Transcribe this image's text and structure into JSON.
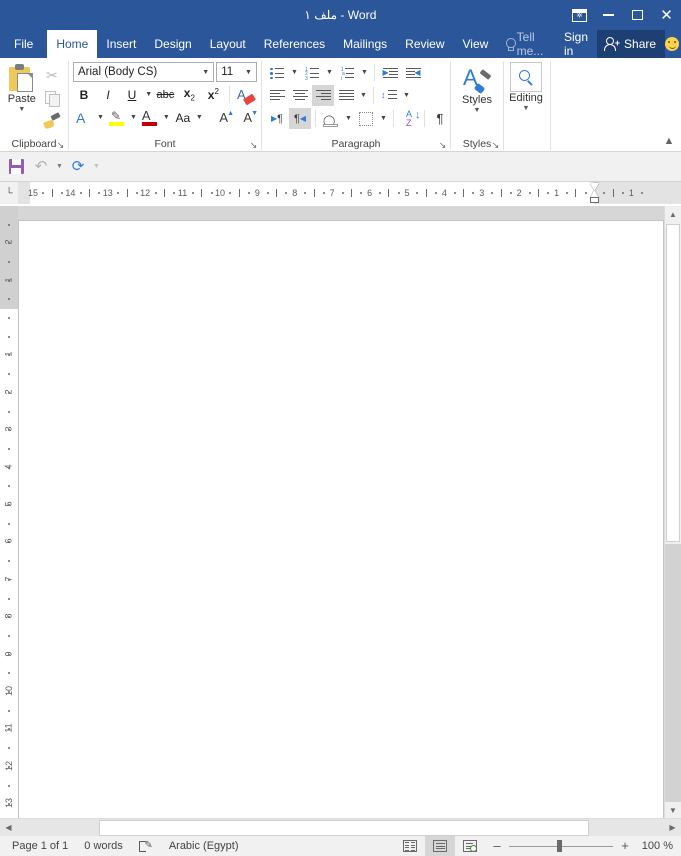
{
  "window": {
    "title": "ملف ١ - Word",
    "ribbon_display_options_tooltip": "Ribbon Display Options",
    "minimize": "–",
    "maximize": "□",
    "close": "✕"
  },
  "tabs": [
    {
      "label": "File",
      "id": "file",
      "active": false
    },
    {
      "label": "Home",
      "id": "home",
      "active": true
    },
    {
      "label": "Insert",
      "id": "insert",
      "active": false
    },
    {
      "label": "Design",
      "id": "design",
      "active": false
    },
    {
      "label": "Layout",
      "id": "layout",
      "active": false
    },
    {
      "label": "References",
      "id": "references",
      "active": false
    },
    {
      "label": "Mailings",
      "id": "mailings",
      "active": false
    },
    {
      "label": "Review",
      "id": "review",
      "active": false
    },
    {
      "label": "View",
      "id": "view",
      "active": false
    }
  ],
  "account": {
    "tell_me": "Tell me...",
    "sign_in": "Sign in",
    "share": "Share",
    "feedback_icon": "smiley-icon"
  },
  "ribbon": {
    "groups": {
      "clipboard": {
        "label": "Clipboard",
        "paste": "Paste",
        "cut_icon": "scissors-icon",
        "copy_icon": "copy-icon",
        "format_painter_icon": "format-painter-icon",
        "launcher": "↘"
      },
      "font": {
        "label": "Font",
        "font_name": "Arial (Body CS)",
        "font_size": "11",
        "bold": "B",
        "italic": "I",
        "underline": "U",
        "strikethrough": "abc",
        "subscript": "x",
        "subscript_sub": "2",
        "superscript": "x",
        "superscript_sup": "2",
        "clear_formatting_icon": "clear-formatting-icon",
        "text_effects_icon": "text-effects-icon",
        "highlight_icon": "text-highlight-icon",
        "font_color_icon": "font-color-icon",
        "change_case": "Aa",
        "grow_font": "A",
        "shrink_font": "A",
        "launcher": "↘"
      },
      "paragraph": {
        "label": "Paragraph",
        "bullets_icon": "bullets-icon",
        "numbering_icon": "numbering-icon",
        "multilevel_icon": "multilevel-list-icon",
        "decrease_indent_icon": "decrease-indent-icon",
        "increase_indent_icon": "increase-indent-icon",
        "align_left_icon": "align-left-icon",
        "align_center_icon": "align-center-icon",
        "align_right_icon": "align-right-icon",
        "justify_icon": "justify-icon",
        "line_spacing_icon": "line-spacing-icon",
        "ltr_icon": "left-to-right-icon",
        "rtl_icon": "right-to-left-icon",
        "shading_icon": "shading-icon",
        "borders_icon": "borders-icon",
        "sort_icon": "sort-icon",
        "show_marks": "¶",
        "active_alignment": "align-right",
        "active_direction": "rtl",
        "launcher": "↘"
      },
      "styles": {
        "label": "Styles",
        "button": "Styles",
        "launcher": "↘"
      },
      "editing": {
        "label": "",
        "button": "Editing",
        "icon": "magnifier-icon"
      }
    },
    "collapse_icon": "chevron-up-icon"
  },
  "quick_access": {
    "save_icon": "save-icon",
    "undo_icon": "undo-icon",
    "redo_icon": "redo-icon",
    "customize_icon": "chevron-down-icon"
  },
  "ruler": {
    "horizontal_labels": [
      "15",
      "14",
      "13",
      "12",
      "11",
      "10",
      "9",
      "8",
      "7",
      "6",
      "5",
      "4",
      "3",
      "2",
      "1",
      "1"
    ],
    "vertical_gray_labels": [
      "2",
      "1"
    ],
    "vertical_page_labels": [
      "1",
      "2",
      "3",
      "4",
      "5",
      "6",
      "7",
      "8",
      "9",
      "10",
      "11",
      "12",
      "13"
    ],
    "direction": "rtl",
    "tab_stop_marker": "└"
  },
  "document": {
    "content": "",
    "page_background": "#ffffff"
  },
  "status_bar": {
    "page": "Page 1 of 1",
    "words": "0 words",
    "proofing_icon": "proofing-errors-icon",
    "language": "Arabic (Egypt)",
    "views": [
      {
        "name": "read-mode",
        "active": false
      },
      {
        "name": "print-layout",
        "active": true
      },
      {
        "name": "web-layout",
        "active": false
      }
    ],
    "zoom_out": "–",
    "zoom_in": "+",
    "zoom_level": "100 %"
  },
  "colors": {
    "title_bar": "#2b579a",
    "accent_blue": "#2e7cd6",
    "share_bg": "#1e3f73",
    "ribbon_bg": "#ffffff",
    "workspace": "#d6d6d6",
    "status_bg": "#f1f1f1",
    "save_purple": "#9b59b6",
    "highlight_yellow": "#ffff00",
    "font_color_red": "#c00000"
  }
}
